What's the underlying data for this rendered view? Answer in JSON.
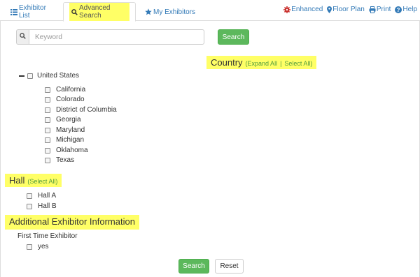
{
  "tabs": {
    "exhibitor_list": "Exhibitor List",
    "advanced_search": "Advanced Search",
    "my_exhibitors": "My Exhibitors"
  },
  "links": {
    "enhanced": "Enhanced",
    "floor_plan": "Floor Plan",
    "print": "Print",
    "help": "Help"
  },
  "search": {
    "placeholder": "Keyword",
    "button": "Search"
  },
  "country": {
    "title": "Country",
    "expand_all": "Expand All",
    "separator": "|",
    "select_all": "Select All",
    "parent": "United States",
    "states": [
      "California",
      "Colorado",
      "District of Columbia",
      "Georgia",
      "Maryland",
      "Michigan",
      "Oklahoma",
      "Texas"
    ]
  },
  "hall": {
    "title": "Hall",
    "select_all": "(Select All)",
    "items": [
      "Hall A",
      "Hall B"
    ]
  },
  "additional_info": {
    "title": "Additional Exhibitor Information",
    "first_time_label": "First Time Exhibitor",
    "first_time_option": "yes"
  },
  "footer": {
    "search": "Search",
    "reset": "Reset"
  },
  "colors": {
    "accent_blue": "#337ab7",
    "highlight": "#ffff66",
    "button_green": "#5cb85c",
    "link_green": "#4f9b3d",
    "enhanced_icon": "#c9302c"
  }
}
